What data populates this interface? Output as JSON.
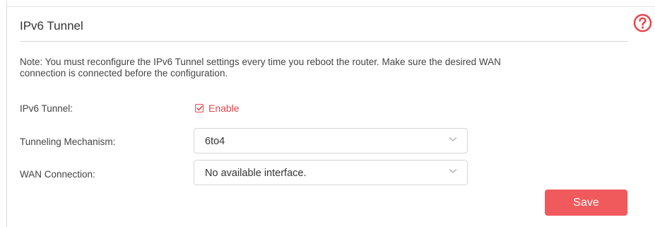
{
  "section": {
    "title": "IPv6 Tunnel"
  },
  "note": {
    "line1": "Note: You must reconfigure the IPv6 Tunnel settings every time you reboot the router. Make sure the desired WAN",
    "line2": "connection is connected before the configuration."
  },
  "fields": {
    "ipv6_tunnel": {
      "label": "IPv6 Tunnel:",
      "checkbox_label": "Enable",
      "checked": true
    },
    "tunneling_mechanism": {
      "label": "Tunneling Mechanism:",
      "value": "6to4"
    },
    "wan_connection": {
      "label": "WAN Connection:",
      "value": "No available interface."
    }
  },
  "actions": {
    "save_label": "Save"
  },
  "icons": {
    "help": "help-circle-icon",
    "check": "checkmark-icon",
    "chevron": "chevron-down-icon"
  },
  "colors": {
    "accent": "#e8474d",
    "button": "#f15a5d",
    "text": "#333333",
    "border": "#d6d6d6"
  }
}
